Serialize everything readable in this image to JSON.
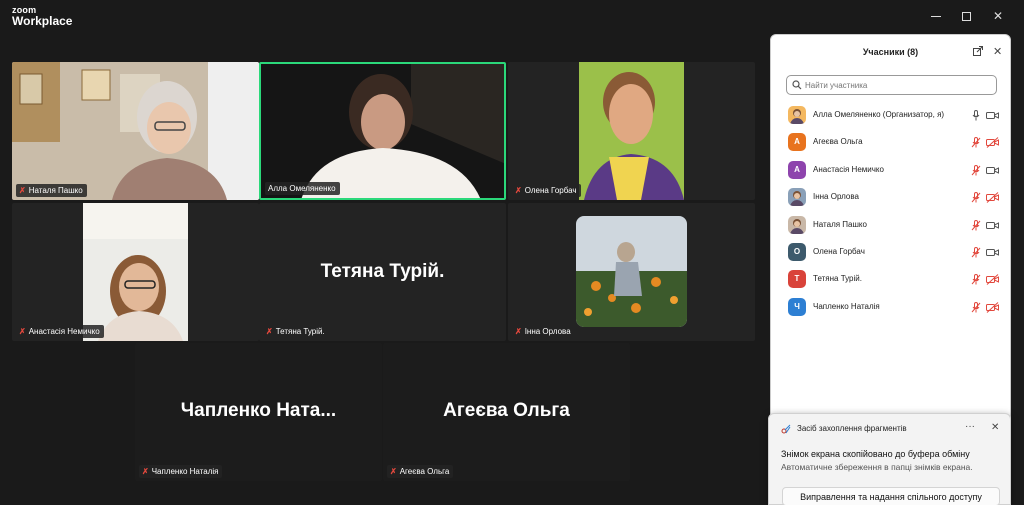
{
  "app": {
    "logo_line1": "zoom",
    "logo_line2": "Workplace"
  },
  "window_controls": {
    "minimize": "—",
    "maximize": "□",
    "close": "✕"
  },
  "tiles": [
    {
      "name": "Наталя Пашко",
      "muted": true,
      "active": false,
      "display_name": ""
    },
    {
      "name": "Алла Омеляненко",
      "muted": false,
      "active": true,
      "display_name": ""
    },
    {
      "name": "Олена Горбач",
      "muted": true,
      "active": false,
      "display_name": ""
    },
    {
      "name": "Анастасія Немичко",
      "muted": true,
      "active": false,
      "display_name": ""
    },
    {
      "name": "Тетяна Турій.",
      "muted": true,
      "active": false,
      "display_name": "Тетяна Турій."
    },
    {
      "name": "Інна Орлова",
      "muted": true,
      "active": false,
      "display_name": ""
    },
    {
      "name": "Чапленко Наталія",
      "muted": true,
      "active": false,
      "display_name": "Чапленко  Ната..."
    },
    {
      "name": "Агеєва Ольга",
      "muted": true,
      "active": false,
      "display_name": "Агеєва Ольга"
    }
  ],
  "participants_panel": {
    "title": "Учасники (8)",
    "search_placeholder": "Найти участника",
    "participants": [
      {
        "name": "Алла Омеляненко (Организатор, я)",
        "initial": "",
        "color": "#f4b860",
        "photo": true,
        "mic_muted": false,
        "cam_off": false
      },
      {
        "name": "Агеєва Ольга",
        "initial": "А",
        "color": "#e8731e",
        "photo": false,
        "mic_muted": true,
        "cam_off": true
      },
      {
        "name": "Анастасія Немичко",
        "initial": "А",
        "color": "#8e44ad",
        "photo": false,
        "mic_muted": true,
        "cam_off": false
      },
      {
        "name": "Інна Орлова",
        "initial": "",
        "color": "#8aa0b8",
        "photo": true,
        "mic_muted": true,
        "cam_off": true
      },
      {
        "name": "Наталя Пашко",
        "initial": "",
        "color": "#c9b8a8",
        "photo": true,
        "mic_muted": true,
        "cam_off": false
      },
      {
        "name": "Олена Горбач",
        "initial": "О",
        "color": "#3d5a6c",
        "photo": false,
        "mic_muted": true,
        "cam_off": false
      },
      {
        "name": "Тетяна Турій.",
        "initial": "Т",
        "color": "#d9433a",
        "photo": false,
        "mic_muted": true,
        "cam_off": true
      },
      {
        "name": "Чапленко Наталія",
        "initial": "Ч",
        "color": "#2d7fd3",
        "photo": false,
        "mic_muted": true,
        "cam_off": true
      }
    ]
  },
  "notification": {
    "app_name": "Засіб захоплення фрагментів",
    "more": "···",
    "close": "✕",
    "title": "Знімок екрана скопійовано до буфера обміну",
    "body": "Автоматичне збереження в папці знімків екрана.",
    "action": "Виправлення та надання спільного доступу"
  },
  "colors": {
    "active_border": "#2bd87a",
    "muted_red": "#e2483d",
    "bg": "#1a1a1a",
    "tile_bg": "#232323"
  }
}
